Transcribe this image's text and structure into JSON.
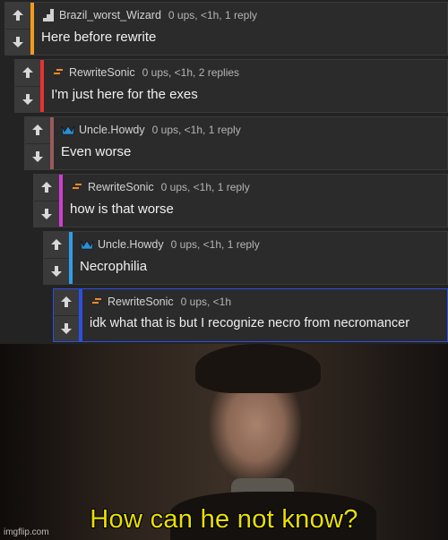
{
  "thread": {
    "comments": [
      {
        "username": "Brazil_worst_Wizard",
        "ups": "0 ups, <1h, 1 reply",
        "text": "Here before rewrite",
        "bar_color": "#f39a1e",
        "icon": "pixel-stairs-icon"
      },
      {
        "username": "RewriteSonic",
        "ups": "0 ups, <1h, 2 replies",
        "text": "I'm just here for the exes",
        "bar_color": "#e63232",
        "icon": "orange-dash-icon"
      },
      {
        "username": "Uncle.Howdy",
        "ups": "0 ups, <1h, 1 reply",
        "text": "Even worse",
        "bar_color": "#9a5a5a",
        "icon": "blue-crown-icon"
      },
      {
        "username": "RewriteSonic",
        "ups": "0 ups, <1h, 1 reply",
        "text": "how is that worse",
        "bar_color": "#d23cd2",
        "icon": "orange-dash-icon"
      },
      {
        "username": "Uncle.Howdy",
        "ups": "0 ups, <1h, 1 reply",
        "text": "Necrophilia",
        "bar_color": "#2f9ee8",
        "icon": "blue-crown-icon"
      },
      {
        "username": "RewriteSonic",
        "ups": "0 ups, <1h",
        "text": "idk what that is but I recognize necro from necromancer",
        "bar_color": "#2d4fe0",
        "icon": "orange-dash-icon"
      }
    ]
  },
  "meme": {
    "caption": "How can he not know?",
    "watermark": "imgflip.com"
  }
}
